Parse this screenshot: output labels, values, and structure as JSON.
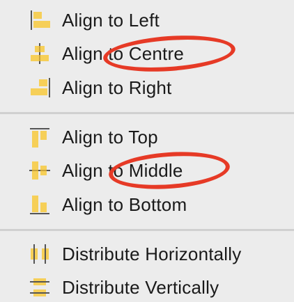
{
  "menu": {
    "items": [
      {
        "label": "Align to Left",
        "icon": "align-left-icon"
      },
      {
        "label": "Align to Centre",
        "icon": "align-centre-icon"
      },
      {
        "label": "Align to Right",
        "icon": "align-right-icon"
      },
      {
        "label": "Align to Top",
        "icon": "align-top-icon"
      },
      {
        "label": "Align to Middle",
        "icon": "align-middle-icon"
      },
      {
        "label": "Align to Bottom",
        "icon": "align-bottom-icon"
      },
      {
        "label": "Distribute Horizontally",
        "icon": "distribute-horizontally-icon"
      },
      {
        "label": "Distribute Vertically",
        "icon": "distribute-vertically-icon"
      }
    ]
  },
  "colors": {
    "background": "#ececec",
    "icon_fill": "#f6cf58",
    "icon_line": "#555555",
    "annotation": "#e63a26"
  }
}
